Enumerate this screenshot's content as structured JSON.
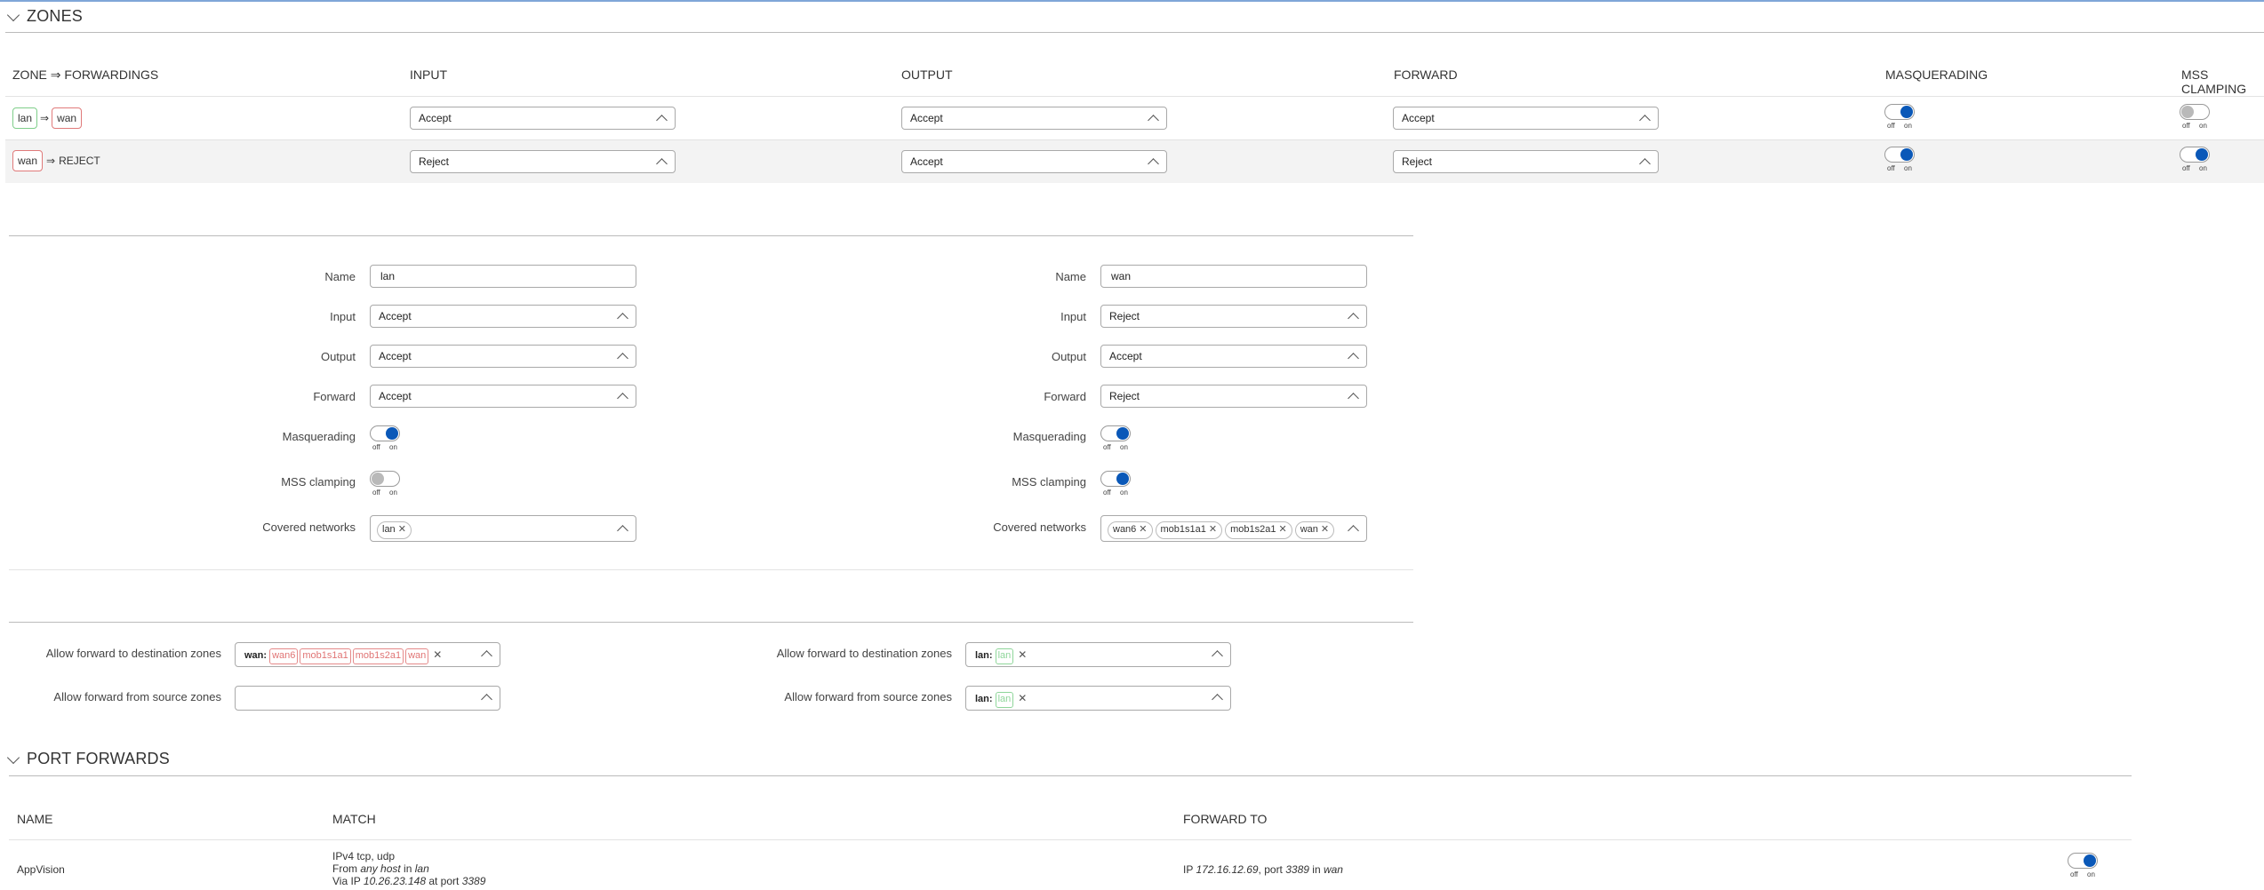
{
  "zones": {
    "title": "ZONES",
    "headers": {
      "zone": "ZONE ⇒ FORWARDINGS",
      "input": "INPUT",
      "output": "OUTPUT",
      "forward": "FORWARD",
      "masquerading": "MASQUERADING",
      "mss": "MSS CLAMPING"
    },
    "rows": [
      {
        "zone": "lan",
        "arrow": "⇒",
        "target": "wan",
        "input": "Accept",
        "output": "Accept",
        "forward": "Accept",
        "masquerading": true,
        "mss": false
      },
      {
        "zone": "wan",
        "arrow": "⇒",
        "target": "REJECT",
        "input": "Reject",
        "output": "Accept",
        "forward": "Reject",
        "masquerading": true,
        "mss": true
      }
    ]
  },
  "toggle_labels": {
    "off": "off",
    "on": "on"
  },
  "zone_forms": [
    {
      "labels": {
        "name": "Name",
        "input": "Input",
        "output": "Output",
        "forward": "Forward",
        "masquerading": "Masquerading",
        "mss": "MSS clamping",
        "networks": "Covered networks"
      },
      "name": "lan",
      "input": "Accept",
      "output": "Accept",
      "forward": "Accept",
      "masquerading": true,
      "mss": false,
      "networks": [
        "lan"
      ]
    },
    {
      "labels": {
        "name": "Name",
        "input": "Input",
        "output": "Output",
        "forward": "Forward",
        "masquerading": "Masquerading",
        "mss": "MSS clamping",
        "networks": "Covered networks"
      },
      "name": "wan",
      "input": "Reject",
      "output": "Accept",
      "forward": "Reject",
      "masquerading": true,
      "mss": true,
      "networks": [
        "wan6",
        "mob1s1a1",
        "mob1s2a1",
        "wan"
      ]
    }
  ],
  "forwardings": [
    {
      "dest_label": "Allow forward to destination zones",
      "src_label": "Allow forward from source zones",
      "dest_zone": "wan:",
      "dest_nets": [
        "wan6",
        "mob1s1a1",
        "mob1s2a1",
        "wan"
      ],
      "src_zone": "",
      "src_nets": []
    },
    {
      "dest_label": "Allow forward to destination zones",
      "src_label": "Allow forward from source zones",
      "dest_zone": "lan:",
      "dest_nets": [
        "lan"
      ],
      "src_zone": "lan:",
      "src_nets": [
        "lan"
      ]
    }
  ],
  "port_forwards": {
    "title": "PORT FORWARDS",
    "headers": {
      "name": "NAME",
      "match": "MATCH",
      "forward_to": "FORWARD TO"
    },
    "rows": [
      {
        "name": "AppVision",
        "match_line1": "IPv4 tcp, udp",
        "match_from_prefix": "From ",
        "match_from_host": "any host",
        "match_from_in": " in ",
        "match_from_zone": "lan",
        "match_via_prefix": "Via IP ",
        "match_via_ip": "10.26.23.148",
        "match_via_at": " at port ",
        "match_via_port": "3389",
        "fwd_prefix": "IP ",
        "fwd_ip": "172.16.12.69",
        "fwd_port_prefix": ", port ",
        "fwd_port": "3389",
        "fwd_in": " in ",
        "fwd_zone": "wan",
        "enabled": true
      }
    ]
  },
  "colors": {
    "accent": "#0a58b8",
    "green_zone": "#7fce8a",
    "red_zone": "#e07a7a"
  }
}
